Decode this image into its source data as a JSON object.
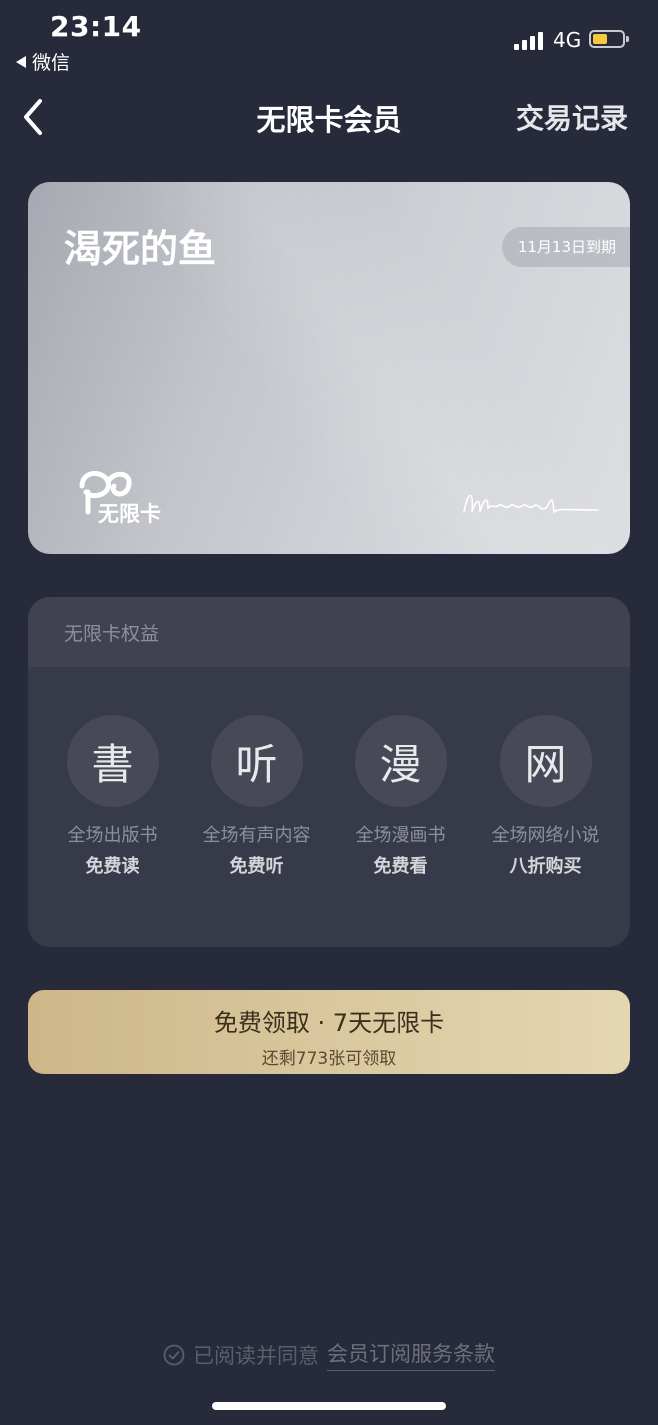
{
  "status_bar": {
    "time": "23:14",
    "back_app": "微信",
    "network": "4G"
  },
  "nav": {
    "title": "无限卡会员",
    "right_action": "交易记录",
    "back_icon": "chevron-left-icon"
  },
  "card": {
    "user_name": "渴死的鱼",
    "expiry": "11月13日到期",
    "logo_text": "无限卡",
    "signature": "Wereads"
  },
  "benefits": {
    "title": "无限卡权益",
    "items": [
      {
        "glyph": "書",
        "line1": "全场出版书",
        "line2": "免费读"
      },
      {
        "glyph": "听",
        "line1": "全场有声内容",
        "line2": "免费听"
      },
      {
        "glyph": "漫",
        "line1": "全场漫画书",
        "line2": "免费看"
      },
      {
        "glyph": "网",
        "line1": "全场网络小说",
        "line2": "八折购买"
      }
    ]
  },
  "claim": {
    "main": "免费领取 · 7天无限卡",
    "sub": "还剩773张可领取"
  },
  "agreement": {
    "prefix": "已阅读并同意",
    "link": "会员订阅服务条款"
  },
  "colors": {
    "background": "#272a3a",
    "panel": "#373a49",
    "gold": "#d9c69c",
    "battery": "#f5c842"
  }
}
